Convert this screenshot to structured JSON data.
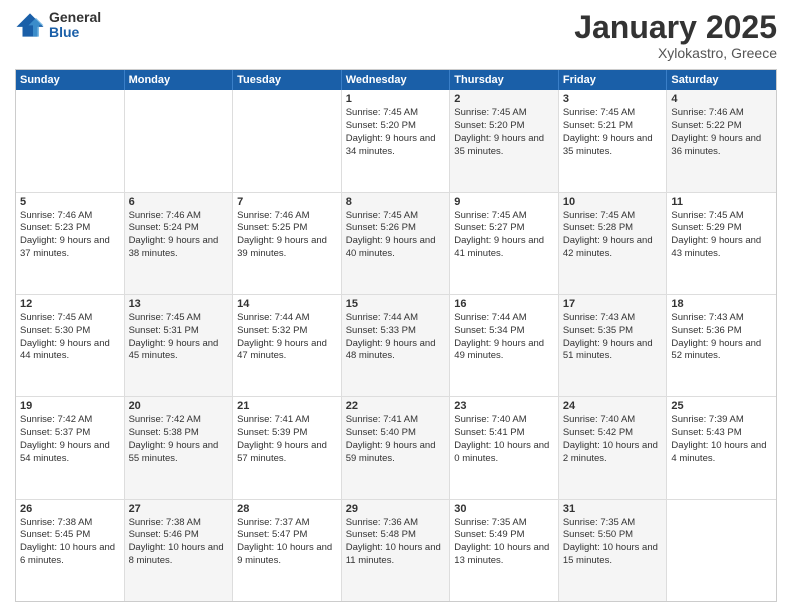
{
  "logo": {
    "general": "General",
    "blue": "Blue"
  },
  "title": "January 2025",
  "subtitle": "Xylokastro, Greece",
  "days": [
    "Sunday",
    "Monday",
    "Tuesday",
    "Wednesday",
    "Thursday",
    "Friday",
    "Saturday"
  ],
  "weeks": [
    [
      {
        "num": "",
        "sunrise": "",
        "sunset": "",
        "daylight": "",
        "shaded": false,
        "empty": true
      },
      {
        "num": "",
        "sunrise": "",
        "sunset": "",
        "daylight": "",
        "shaded": false,
        "empty": true
      },
      {
        "num": "",
        "sunrise": "",
        "sunset": "",
        "daylight": "",
        "shaded": false,
        "empty": true
      },
      {
        "num": "1",
        "sunrise": "Sunrise: 7:45 AM",
        "sunset": "Sunset: 5:20 PM",
        "daylight": "Daylight: 9 hours and 34 minutes.",
        "shaded": false,
        "empty": false
      },
      {
        "num": "2",
        "sunrise": "Sunrise: 7:45 AM",
        "sunset": "Sunset: 5:20 PM",
        "daylight": "Daylight: 9 hours and 35 minutes.",
        "shaded": true,
        "empty": false
      },
      {
        "num": "3",
        "sunrise": "Sunrise: 7:45 AM",
        "sunset": "Sunset: 5:21 PM",
        "daylight": "Daylight: 9 hours and 35 minutes.",
        "shaded": false,
        "empty": false
      },
      {
        "num": "4",
        "sunrise": "Sunrise: 7:46 AM",
        "sunset": "Sunset: 5:22 PM",
        "daylight": "Daylight: 9 hours and 36 minutes.",
        "shaded": true,
        "empty": false
      }
    ],
    [
      {
        "num": "5",
        "sunrise": "Sunrise: 7:46 AM",
        "sunset": "Sunset: 5:23 PM",
        "daylight": "Daylight: 9 hours and 37 minutes.",
        "shaded": false,
        "empty": false
      },
      {
        "num": "6",
        "sunrise": "Sunrise: 7:46 AM",
        "sunset": "Sunset: 5:24 PM",
        "daylight": "Daylight: 9 hours and 38 minutes.",
        "shaded": true,
        "empty": false
      },
      {
        "num": "7",
        "sunrise": "Sunrise: 7:46 AM",
        "sunset": "Sunset: 5:25 PM",
        "daylight": "Daylight: 9 hours and 39 minutes.",
        "shaded": false,
        "empty": false
      },
      {
        "num": "8",
        "sunrise": "Sunrise: 7:45 AM",
        "sunset": "Sunset: 5:26 PM",
        "daylight": "Daylight: 9 hours and 40 minutes.",
        "shaded": true,
        "empty": false
      },
      {
        "num": "9",
        "sunrise": "Sunrise: 7:45 AM",
        "sunset": "Sunset: 5:27 PM",
        "daylight": "Daylight: 9 hours and 41 minutes.",
        "shaded": false,
        "empty": false
      },
      {
        "num": "10",
        "sunrise": "Sunrise: 7:45 AM",
        "sunset": "Sunset: 5:28 PM",
        "daylight": "Daylight: 9 hours and 42 minutes.",
        "shaded": true,
        "empty": false
      },
      {
        "num": "11",
        "sunrise": "Sunrise: 7:45 AM",
        "sunset": "Sunset: 5:29 PM",
        "daylight": "Daylight: 9 hours and 43 minutes.",
        "shaded": false,
        "empty": false
      }
    ],
    [
      {
        "num": "12",
        "sunrise": "Sunrise: 7:45 AM",
        "sunset": "Sunset: 5:30 PM",
        "daylight": "Daylight: 9 hours and 44 minutes.",
        "shaded": false,
        "empty": false
      },
      {
        "num": "13",
        "sunrise": "Sunrise: 7:45 AM",
        "sunset": "Sunset: 5:31 PM",
        "daylight": "Daylight: 9 hours and 45 minutes.",
        "shaded": true,
        "empty": false
      },
      {
        "num": "14",
        "sunrise": "Sunrise: 7:44 AM",
        "sunset": "Sunset: 5:32 PM",
        "daylight": "Daylight: 9 hours and 47 minutes.",
        "shaded": false,
        "empty": false
      },
      {
        "num": "15",
        "sunrise": "Sunrise: 7:44 AM",
        "sunset": "Sunset: 5:33 PM",
        "daylight": "Daylight: 9 hours and 48 minutes.",
        "shaded": true,
        "empty": false
      },
      {
        "num": "16",
        "sunrise": "Sunrise: 7:44 AM",
        "sunset": "Sunset: 5:34 PM",
        "daylight": "Daylight: 9 hours and 49 minutes.",
        "shaded": false,
        "empty": false
      },
      {
        "num": "17",
        "sunrise": "Sunrise: 7:43 AM",
        "sunset": "Sunset: 5:35 PM",
        "daylight": "Daylight: 9 hours and 51 minutes.",
        "shaded": true,
        "empty": false
      },
      {
        "num": "18",
        "sunrise": "Sunrise: 7:43 AM",
        "sunset": "Sunset: 5:36 PM",
        "daylight": "Daylight: 9 hours and 52 minutes.",
        "shaded": false,
        "empty": false
      }
    ],
    [
      {
        "num": "19",
        "sunrise": "Sunrise: 7:42 AM",
        "sunset": "Sunset: 5:37 PM",
        "daylight": "Daylight: 9 hours and 54 minutes.",
        "shaded": false,
        "empty": false
      },
      {
        "num": "20",
        "sunrise": "Sunrise: 7:42 AM",
        "sunset": "Sunset: 5:38 PM",
        "daylight": "Daylight: 9 hours and 55 minutes.",
        "shaded": true,
        "empty": false
      },
      {
        "num": "21",
        "sunrise": "Sunrise: 7:41 AM",
        "sunset": "Sunset: 5:39 PM",
        "daylight": "Daylight: 9 hours and 57 minutes.",
        "shaded": false,
        "empty": false
      },
      {
        "num": "22",
        "sunrise": "Sunrise: 7:41 AM",
        "sunset": "Sunset: 5:40 PM",
        "daylight": "Daylight: 9 hours and 59 minutes.",
        "shaded": true,
        "empty": false
      },
      {
        "num": "23",
        "sunrise": "Sunrise: 7:40 AM",
        "sunset": "Sunset: 5:41 PM",
        "daylight": "Daylight: 10 hours and 0 minutes.",
        "shaded": false,
        "empty": false
      },
      {
        "num": "24",
        "sunrise": "Sunrise: 7:40 AM",
        "sunset": "Sunset: 5:42 PM",
        "daylight": "Daylight: 10 hours and 2 minutes.",
        "shaded": true,
        "empty": false
      },
      {
        "num": "25",
        "sunrise": "Sunrise: 7:39 AM",
        "sunset": "Sunset: 5:43 PM",
        "daylight": "Daylight: 10 hours and 4 minutes.",
        "shaded": false,
        "empty": false
      }
    ],
    [
      {
        "num": "26",
        "sunrise": "Sunrise: 7:38 AM",
        "sunset": "Sunset: 5:45 PM",
        "daylight": "Daylight: 10 hours and 6 minutes.",
        "shaded": false,
        "empty": false
      },
      {
        "num": "27",
        "sunrise": "Sunrise: 7:38 AM",
        "sunset": "Sunset: 5:46 PM",
        "daylight": "Daylight: 10 hours and 8 minutes.",
        "shaded": true,
        "empty": false
      },
      {
        "num": "28",
        "sunrise": "Sunrise: 7:37 AM",
        "sunset": "Sunset: 5:47 PM",
        "daylight": "Daylight: 10 hours and 9 minutes.",
        "shaded": false,
        "empty": false
      },
      {
        "num": "29",
        "sunrise": "Sunrise: 7:36 AM",
        "sunset": "Sunset: 5:48 PM",
        "daylight": "Daylight: 10 hours and 11 minutes.",
        "shaded": true,
        "empty": false
      },
      {
        "num": "30",
        "sunrise": "Sunrise: 7:35 AM",
        "sunset": "Sunset: 5:49 PM",
        "daylight": "Daylight: 10 hours and 13 minutes.",
        "shaded": false,
        "empty": false
      },
      {
        "num": "31",
        "sunrise": "Sunrise: 7:35 AM",
        "sunset": "Sunset: 5:50 PM",
        "daylight": "Daylight: 10 hours and 15 minutes.",
        "shaded": true,
        "empty": false
      },
      {
        "num": "",
        "sunrise": "",
        "sunset": "",
        "daylight": "",
        "shaded": false,
        "empty": true
      }
    ]
  ]
}
